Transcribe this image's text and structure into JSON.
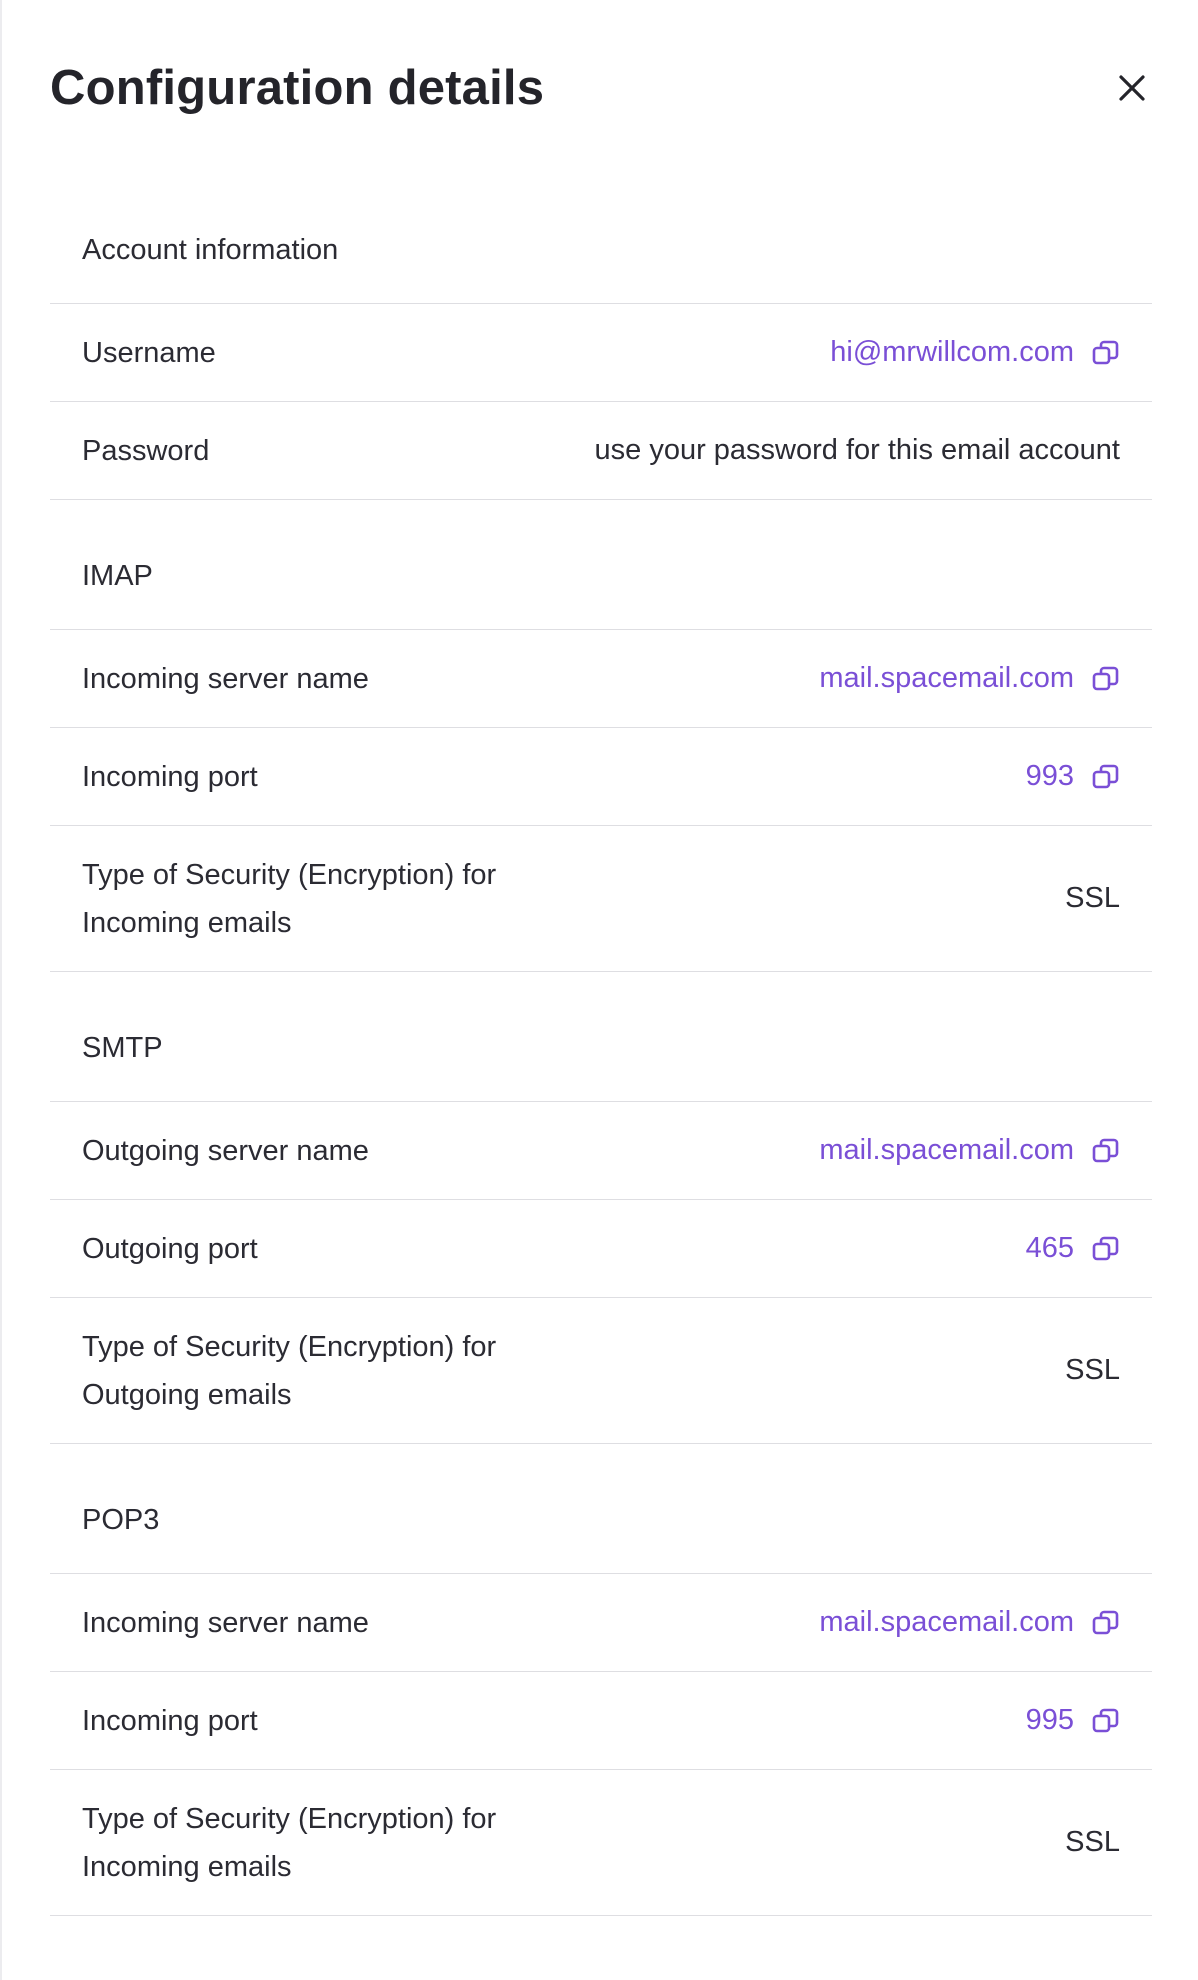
{
  "panel": {
    "title": "Configuration details",
    "close_icon": "close-icon",
    "copy_icon": "copy-icon"
  },
  "colors": {
    "accent": "#7a4fd6",
    "text": "#2b2b33",
    "divider": "#dedee2"
  },
  "account": {
    "title": "Account information",
    "username_label": "Username",
    "username_value": "hi@mrwillcom.com",
    "password_label": "Password",
    "password_value": "use your password for this email account"
  },
  "imap": {
    "title": "IMAP",
    "server_label": "Incoming server name",
    "server_value": "mail.spacemail.com",
    "port_label": "Incoming port",
    "port_value": "993",
    "security_label": "Type of Security (Encryption) for Incoming emails",
    "security_value": "SSL"
  },
  "smtp": {
    "title": "SMTP",
    "server_label": "Outgoing server name",
    "server_value": "mail.spacemail.com",
    "port_label": "Outgoing port",
    "port_value": "465",
    "security_label": "Type of Security (Encryption) for Outgoing emails",
    "security_value": "SSL"
  },
  "pop3": {
    "title": "POP3",
    "server_label": "Incoming server name",
    "server_value": "mail.spacemail.com",
    "port_label": "Incoming port",
    "port_value": "995",
    "security_label": "Type of Security (Encryption) for Incoming emails",
    "security_value": "SSL"
  }
}
